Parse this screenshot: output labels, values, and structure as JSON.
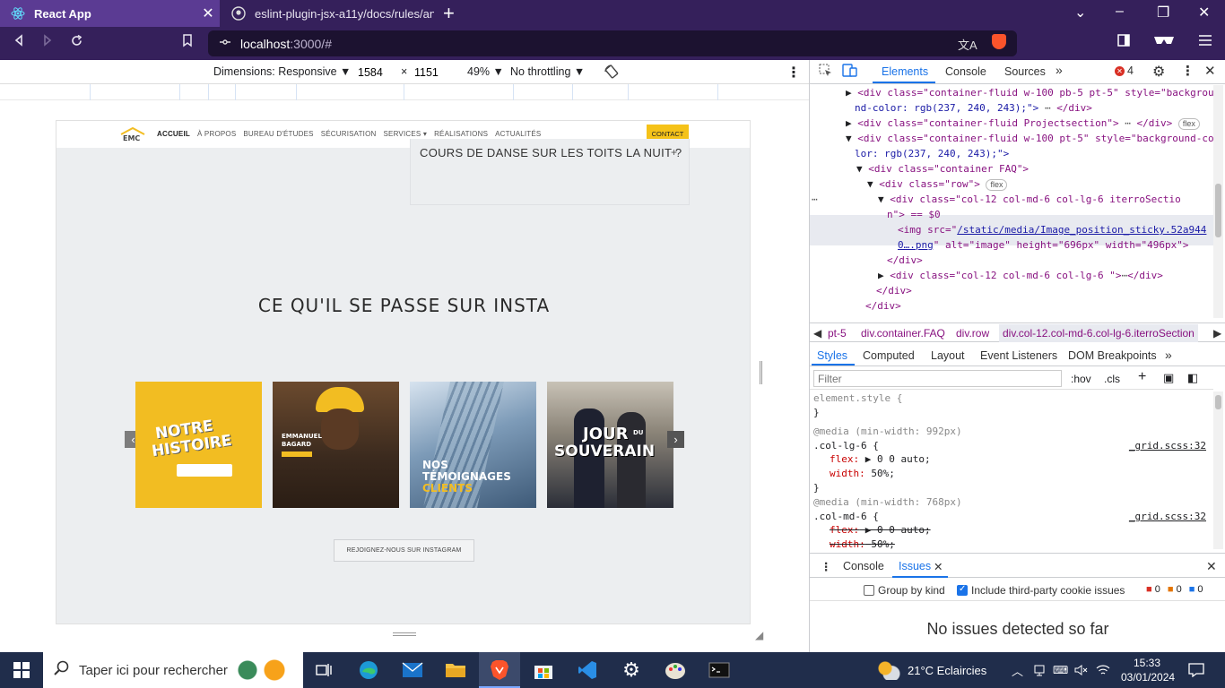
{
  "browser": {
    "tabs": [
      {
        "title": "React App",
        "active": true,
        "close": "✕"
      },
      {
        "title": "eslint-plugin-jsx-a11y/docs/rules/anch",
        "active": false
      }
    ],
    "new_tab": "+",
    "url_host": "localhost",
    "url_path": ":3000/#",
    "window_controls": [
      "⌄",
      "–",
      "❐",
      "✕"
    ]
  },
  "device_toolbar": {
    "dimensions_label": "Dimensions: Responsive ▼",
    "width": "1584",
    "x_sep": "×",
    "height": "1151",
    "zoom": "49% ▼",
    "throttling": "No throttling ▼"
  },
  "site": {
    "nav": [
      "ACCUEIL",
      "À PROPOS",
      "BUREAU D'ÉTUDES",
      "SÉCURISATION",
      "SERVICES ▾",
      "RÉALISATIONS",
      "ACTUALITÉS"
    ],
    "contact": "CONTACT",
    "faq_question": "COURS DE DANSE SUR LES TOITS LA NUIT ?",
    "faq_plus": "+",
    "insta_title": "CE QU'IL SE PASSE SUR INSTA",
    "tiles": [
      {
        "line1": "NOTRE",
        "line2": "HISTOIRE",
        "color": "#f2bd22"
      },
      {
        "line1": "EMMANUEL",
        "line2": "BAGARD",
        "color": "#4a3a2a"
      },
      {
        "line1": "NOS",
        "line2": "TÉMOIGNAGES",
        "line3": "CLIENTS",
        "color": "#6e8ca8"
      },
      {
        "line1": "JOUR",
        "sup": "DU",
        "line2": "SOUVERAIN",
        "color": "#3a3f4b"
      }
    ],
    "prev": "‹",
    "next": "›",
    "join": "REJOIGNEZ-NOUS SUR INSTAGRAM"
  },
  "devtools": {
    "tabs": [
      "Elements",
      "Console",
      "Sources",
      "»"
    ],
    "error_count": "4",
    "dom": [
      "<div class=\"container-fluid w-100 pb-5 pt-5\" style=\"backgrou",
      "nd-color: rgb(237, 240, 243);\">",
      "</div>",
      "<div class=\"container-fluid Projectsection\">",
      "</div>",
      "<div class=\"container-fluid w-100 pt-5\" style=\"background-co",
      "lor: rgb(237, 240, 243);\">",
      "<div class=\"container FAQ\">",
      "<div class=\"row\">",
      "<div class=\"col-12 col-md-6 col-lg-6 iterroSectio",
      "n\"> == $0",
      "<img src=\"",
      "/static/media/Image_position_sticky.52a944",
      "0….png",
      "\" alt=\"image\" height=\"696px\" width=\"496px\">",
      "</div>",
      "<div class=\"col-12 col-md-6 col-lg-6 \">",
      "</div>",
      "</div>",
      "</div>"
    ],
    "flex_badge": "flex",
    "breadcrumbs": [
      "pt-5",
      "div.container.FAQ",
      "div.row",
      "div.col-12.col-md-6.col-lg-6.iterroSection"
    ],
    "sub_tabs": [
      "Styles",
      "Computed",
      "Layout",
      "Event Listeners",
      "DOM Breakpoints",
      "»"
    ],
    "filter_placeholder": "Filter",
    "hov": ":hov",
    "cls": ".cls",
    "styles": {
      "element_style": "element.style {",
      "close": "}",
      "media1": "@media (min-width: 992px)",
      "selector1": ".col-lg-6 {",
      "flex": "flex:",
      "flex_val": "▶ 0 0 auto;",
      "width": "width:",
      "width_val": "50%;",
      "src": "_grid.scss:32",
      "media2": "@media (min-width: 768px)",
      "selector2": ".col-md-6 {"
    },
    "drawer_tabs": [
      "Console",
      "Issues"
    ],
    "group_by_kind": "Group by kind",
    "include_third_party": "Include third-party cookie issues",
    "counts": [
      "0",
      "0",
      "0"
    ],
    "no_issues": "No issues detected so far"
  },
  "taskbar": {
    "search_placeholder": "Taper ici pour rechercher",
    "weather": "21°C  Eclaircies",
    "time": "15:33",
    "date": "03/01/2024"
  }
}
